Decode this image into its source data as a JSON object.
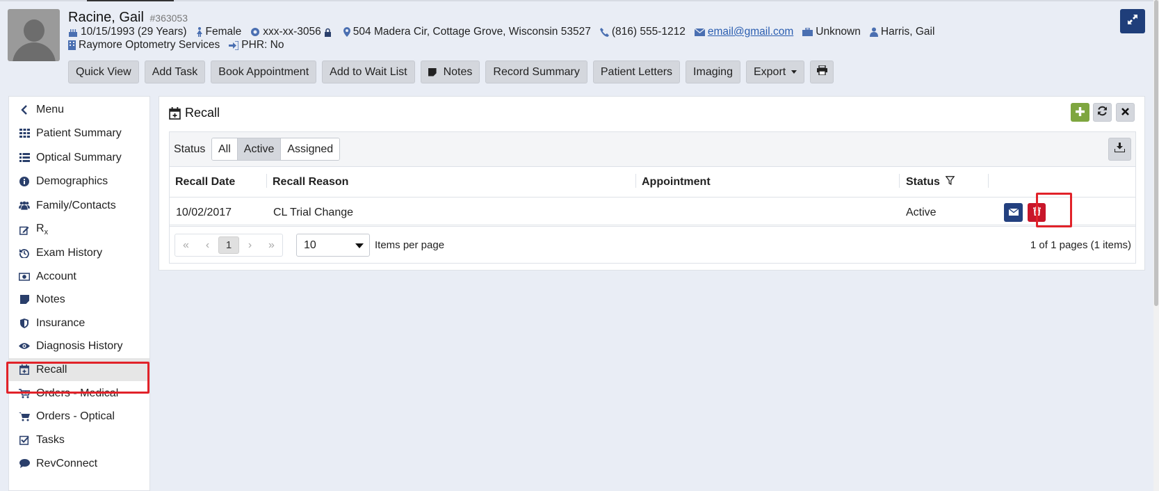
{
  "patient": {
    "name": "Racine, Gail",
    "id": "#363053",
    "dob": "10/15/1993 (29 Years)",
    "gender": "Female",
    "ssn": "xxx-xx-3056",
    "address": "504 Madera Cir, Cottage Grove, Wisconsin 53527",
    "phone": "(816) 555-1212",
    "email": "email@gmail.com",
    "employment": "Unknown",
    "provider": "Harris, Gail",
    "practice": "Raymore Optometry Services",
    "phr": "PHR: No"
  },
  "toolbar": {
    "quick_view": "Quick View",
    "add_task": "Add Task",
    "book_appointment": "Book Appointment",
    "add_wait_list": "Add to Wait List",
    "notes": "Notes",
    "record_summary": "Record Summary",
    "patient_letters": "Patient Letters",
    "imaging": "Imaging",
    "export": "Export"
  },
  "sidebar": {
    "items": [
      {
        "label": "Menu",
        "icon": "chevron-left-icon"
      },
      {
        "label": "Patient Summary",
        "icon": "grid-icon"
      },
      {
        "label": "Optical Summary",
        "icon": "list-icon"
      },
      {
        "label": "Demographics",
        "icon": "info-icon"
      },
      {
        "label": "Family/Contacts",
        "icon": "users-icon"
      },
      {
        "label": "R",
        "sub": "x",
        "icon": "edit-icon"
      },
      {
        "label": "Exam History",
        "icon": "history-icon"
      },
      {
        "label": "Account",
        "icon": "money-icon"
      },
      {
        "label": "Notes",
        "icon": "note-icon"
      },
      {
        "label": "Insurance",
        "icon": "shield-icon"
      },
      {
        "label": "Diagnosis History",
        "icon": "eye-icon"
      },
      {
        "label": "Recall",
        "icon": "calendar-plus-icon"
      },
      {
        "label": "Orders - Medical",
        "icon": "cart-plus-icon"
      },
      {
        "label": "Orders - Optical",
        "icon": "cart-icon"
      },
      {
        "label": "Tasks",
        "icon": "check-square-icon"
      },
      {
        "label": "RevConnect",
        "icon": "comment-icon"
      }
    ],
    "active": "Recall"
  },
  "recall": {
    "title": "Recall",
    "status_label": "Status",
    "filters": [
      "All",
      "Active",
      "Assigned"
    ],
    "active_filter": "Active",
    "columns": [
      "Recall Date",
      "Recall Reason",
      "Appointment",
      "Status"
    ],
    "rows": [
      {
        "date": "10/02/2017",
        "reason": "CL Trial Change",
        "appointment": "",
        "status": "Active"
      }
    ],
    "pager": {
      "current_page": "1",
      "page_size": "10",
      "items_per_page_label": "Items per page",
      "info": "1 of 1 pages (1 items)"
    }
  },
  "colors": {
    "accent_navy": "#1f3e7a",
    "add_green": "#7ea63f",
    "delete_red": "#c8162a",
    "highlight_red": "#e12229"
  }
}
